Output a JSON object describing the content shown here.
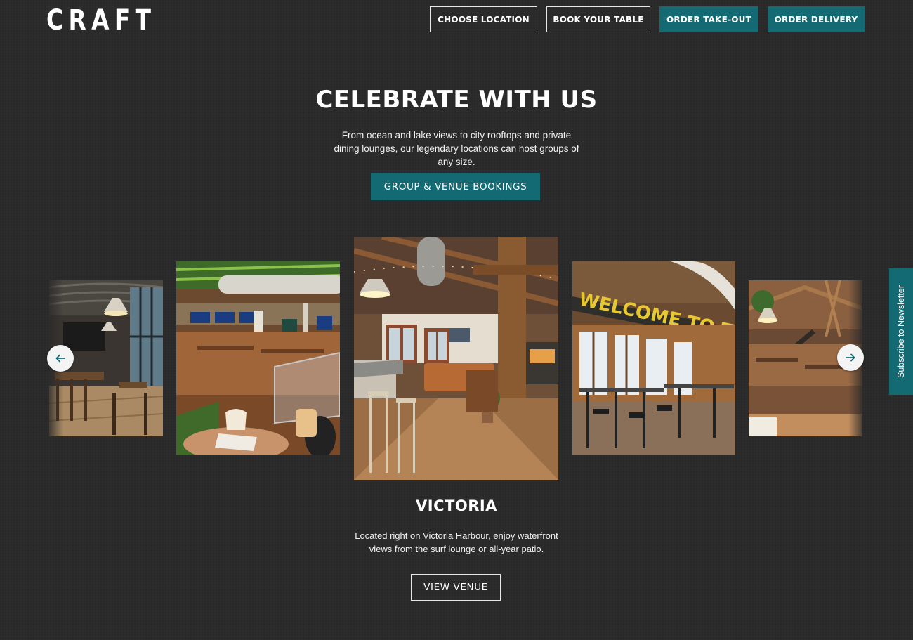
{
  "header": {
    "logo": "CRAFT",
    "nav": [
      {
        "label": "CHOOSE LOCATION"
      },
      {
        "label": "BOOK YOUR TABLE"
      },
      {
        "label": "ORDER TAKE-OUT"
      },
      {
        "label": "ORDER DELIVERY"
      }
    ]
  },
  "hero": {
    "title": "CELEBRATE WITH US",
    "text": "From ocean and lake views to city rooftops and private dining lounges, our legendary locations can host groups of any size.",
    "cta": "GROUP & VENUE BOOKINGS"
  },
  "carousel": {
    "prev_icon": "arrow-left-icon",
    "next_icon": "arrow-right-icon",
    "slides": [
      {
        "image": "restaurant-interior-bar-windows"
      },
      {
        "image": "restaurant-interior-green-ceiling"
      },
      {
        "image": "restaurant-interior-timber-beams",
        "active": true
      },
      {
        "image": "restaurant-interior-welcome-sign",
        "sign": "WELCOME TO THE GOOD LIFE"
      },
      {
        "image": "restaurant-interior-open-hall"
      }
    ]
  },
  "active_venue": {
    "name": "VICTORIA",
    "description": "Located right on Victoria Harbour, enjoy waterfront views from the surf lounge or all-year patio.",
    "cta": "VIEW VENUE"
  },
  "newsletter_tab": {
    "label": "Subscribe to Newsletter"
  },
  "colors": {
    "background": "#2a2a2a",
    "accent": "#136a73",
    "text": "#ffffff"
  }
}
